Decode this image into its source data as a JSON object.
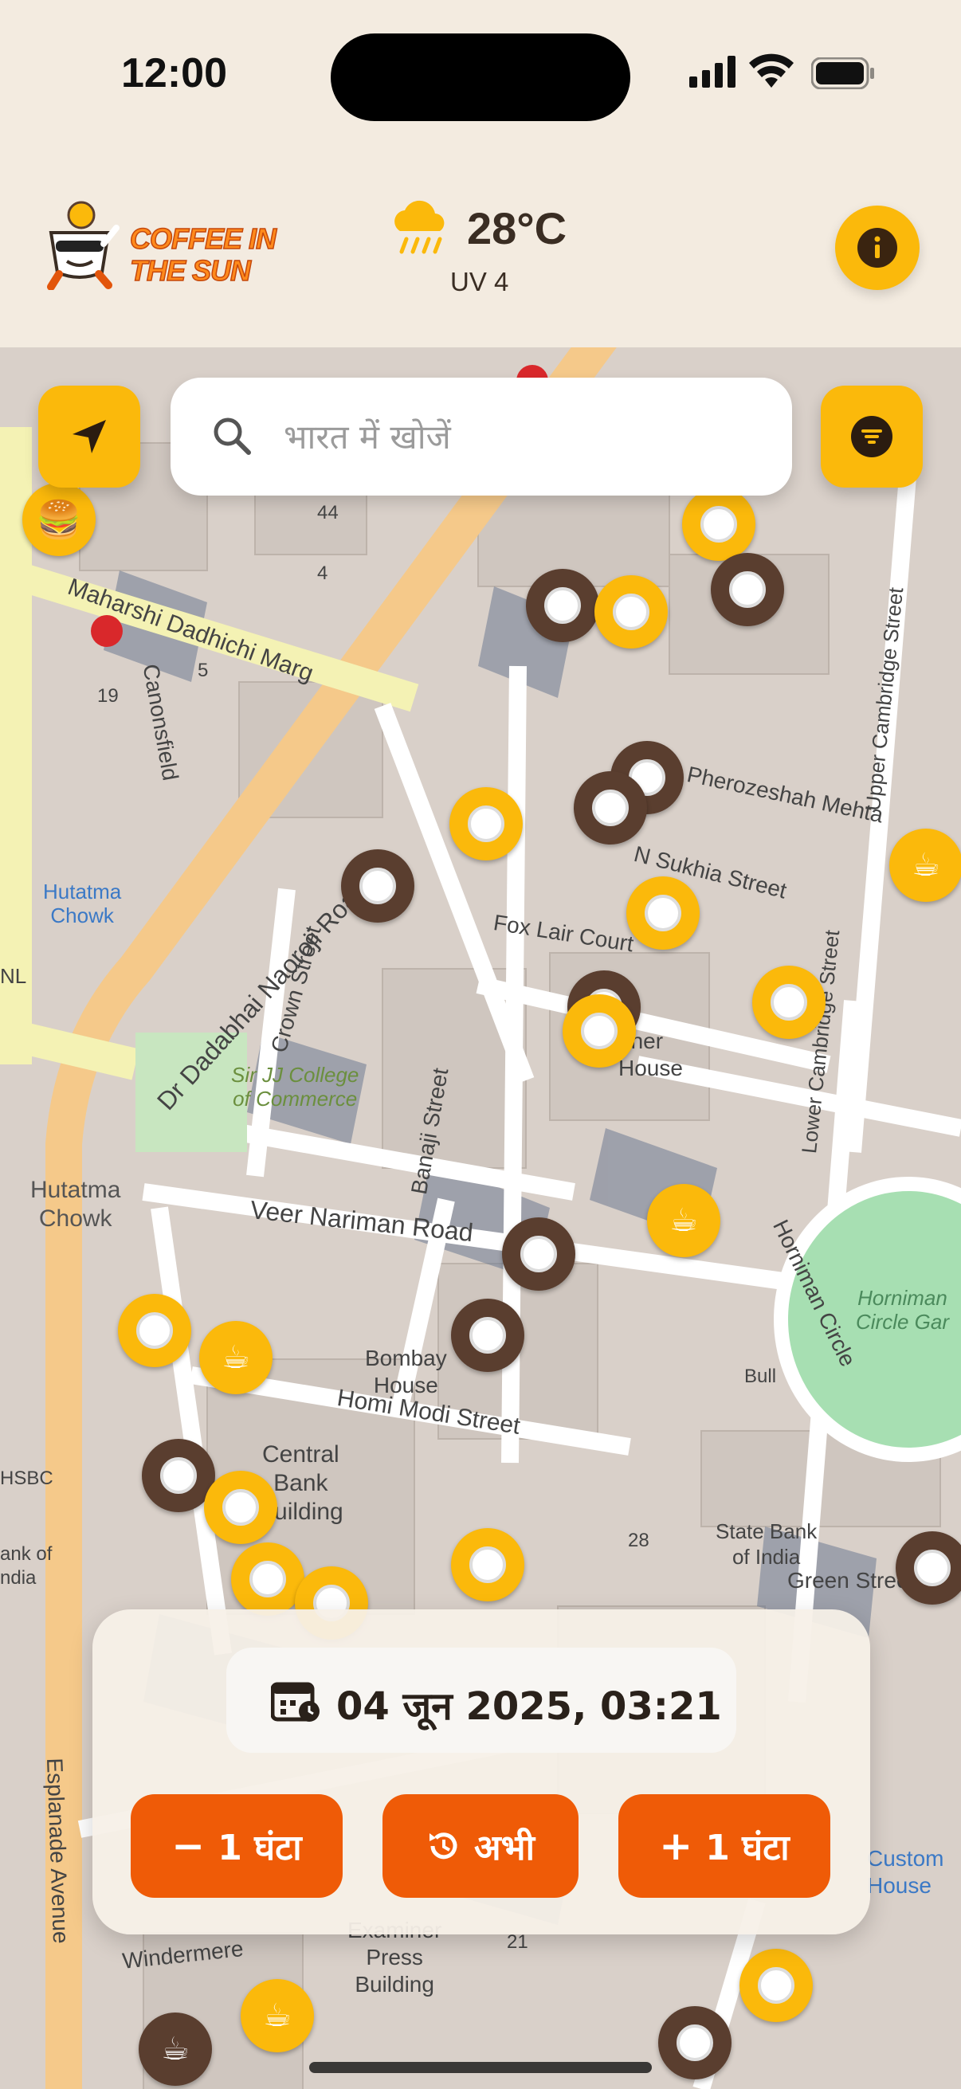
{
  "status_bar": {
    "time": "12:00"
  },
  "header": {
    "brand_line1": "COFFEE IN",
    "brand_line2": "THE SUN",
    "temperature": "28°C",
    "uv": "UV 4"
  },
  "search": {
    "placeholder": "भारत में खोजें"
  },
  "map_labels": {
    "street_1": "Maharshi Dadhichi Marg",
    "street_2": "Dr Dadabhai Naoroji Road",
    "street_3": "Veer Nariman Road",
    "street_4": "Homi Modi Street",
    "street_5": "Fox Lair Court",
    "street_6": "N Sukhia Street",
    "street_7": "Pherozeshah Mehta",
    "street_8": "Crown Street",
    "street_9": "Banaji Street",
    "street_10": "Horniman Circle",
    "street_11": "Lower Cambridge Street",
    "street_12": "Upper Cambridge Street",
    "street_13": "Esplanade Avenue",
    "street_14": "Green Street",
    "street_15": "Windermere",
    "street_16": "Canonsfield",
    "place_1": "Hutatma\nChowk",
    "place_2": "Hutatma\nChowk",
    "place_3": "Sir JJ College\nof Commerce",
    "place_4": "Bombay\nHouse",
    "place_5": "Central\nBank\nBuilding",
    "place_6": "State Bank\nof India",
    "place_7": "Horniman\nCircle Gar",
    "place_8": "Custom\nHouse",
    "place_9": "Examiner\nPress\nBuilding",
    "place_10": "HSBC",
    "place_11": "NL",
    "place_12": "Bull",
    "place_13": "eher\nHouse",
    "place_14": "ank of\nndia",
    "num_44": "44",
    "num_4": "4",
    "num_19": "19",
    "num_5": "5",
    "num_28": "28",
    "num_21": "21"
  },
  "bottom_panel": {
    "datetime": "04 जून 2025, 03:21",
    "minus_label": "1 घंटा",
    "now_label": "अभी",
    "plus_label": "1 घंटा"
  }
}
